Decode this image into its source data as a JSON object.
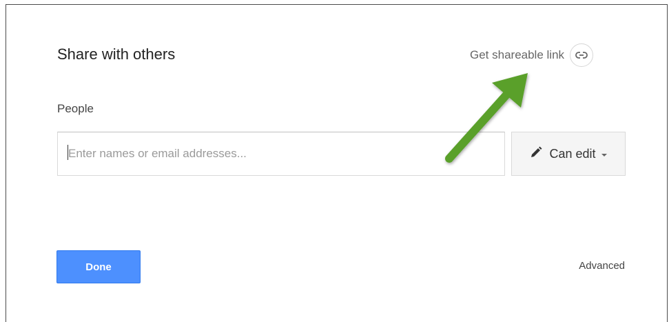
{
  "dialog": {
    "title": "Share with others",
    "share_link_label": "Get shareable link",
    "link_icon": "link-icon",
    "people_label": "People",
    "people_input": {
      "value": "",
      "placeholder": "Enter names or email addresses..."
    },
    "permission": {
      "icon": "pencil-icon",
      "label": "Can edit",
      "dropdown_icon": "caret-down-icon"
    },
    "done_label": "Done",
    "advanced_label": "Advanced"
  },
  "annotation": {
    "arrow_color": "#5aa02c",
    "arrow_icon": "arrow-icon"
  },
  "colors": {
    "primary_button": "#4d90fe",
    "text_primary": "#222222",
    "text_secondary": "#666666"
  }
}
